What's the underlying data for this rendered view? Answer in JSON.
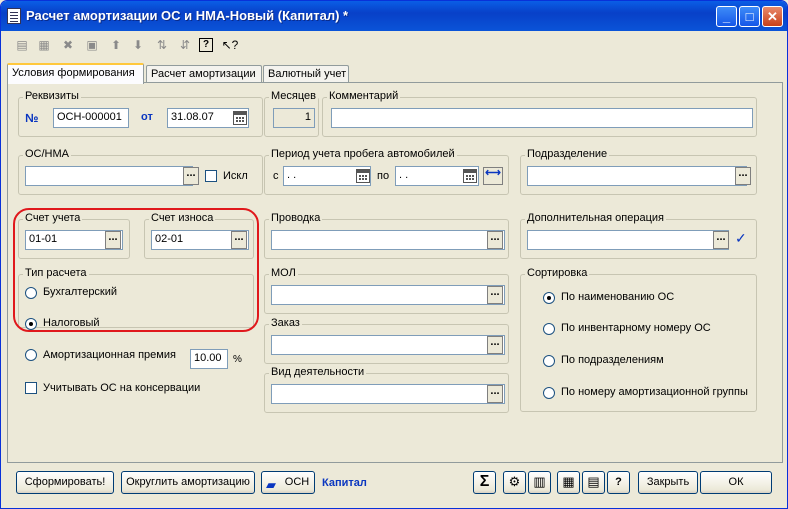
{
  "window": {
    "title": "Расчет амортизации ОС и НМА-Новый (Капитал) *",
    "minimize": "_",
    "maximize": "□",
    "close": "✕"
  },
  "toolbar": {
    "icons": [
      "new-icon",
      "copy-icon",
      "delete-icon",
      "edit-icon",
      "up-arrow-icon",
      "down-arrow-icon",
      "sort-asc-icon",
      "sort-desc-icon",
      "help-icon",
      "pointer-help-icon"
    ]
  },
  "tabs": [
    "Условия формирования",
    "Расчет амортизации",
    "Валютный учет"
  ],
  "requisites": {
    "title": "Реквизиты",
    "num_label": "№",
    "num_value": "ОСН-000001",
    "date_label": "от",
    "date_value": "31.08.07"
  },
  "months": {
    "title": "Месяцев",
    "value": "1"
  },
  "comment": {
    "title": "Комментарий",
    "value": ""
  },
  "os_nma": {
    "title": "ОС/НМА",
    "value": "",
    "excl_label": "Искл"
  },
  "mileage": {
    "title": "Период учета пробега автомобилей",
    "from_label": "с",
    "from_value": ". .",
    "to_label": "по",
    "to_value": ". ."
  },
  "division": {
    "title": "Подразделение",
    "value": ""
  },
  "account": {
    "title": "Счет учета",
    "value": "01-01"
  },
  "depreciation_account": {
    "title": "Счет износа",
    "value": "02-01"
  },
  "posting": {
    "title": "Проводка",
    "value": ""
  },
  "extra_operation": {
    "title": "Дополнительная операция",
    "value": ""
  },
  "calc_type": {
    "title": "Тип расчета",
    "options": [
      "Бухгалтерский",
      "Налоговый"
    ],
    "selected": "Налоговый"
  },
  "mol": {
    "title": "МОЛ",
    "value": ""
  },
  "sorting": {
    "title": "Сортировка",
    "options": [
      "По наименованию ОС",
      "По инвентарному номеру ОС",
      "По подразделениям",
      "По номеру амортизационной группы"
    ],
    "selected": "По наименованию ОС"
  },
  "order": {
    "title": "Заказ",
    "value": ""
  },
  "bonus": {
    "label": "Амортизационная премия",
    "value": "10.00",
    "unit": "%"
  },
  "activity": {
    "title": "Вид деятельности",
    "value": ""
  },
  "conservation": {
    "label": "Учитывать ОС на консервации"
  },
  "bottom": {
    "form_btn": "Сформировать!",
    "round_btn": "Округлить амортизацию",
    "osn_btn": "ОСН",
    "capital_label": "Капитал",
    "sum_btn": "Σ",
    "close_btn": "Закрыть",
    "ok_btn": "ОК"
  }
}
